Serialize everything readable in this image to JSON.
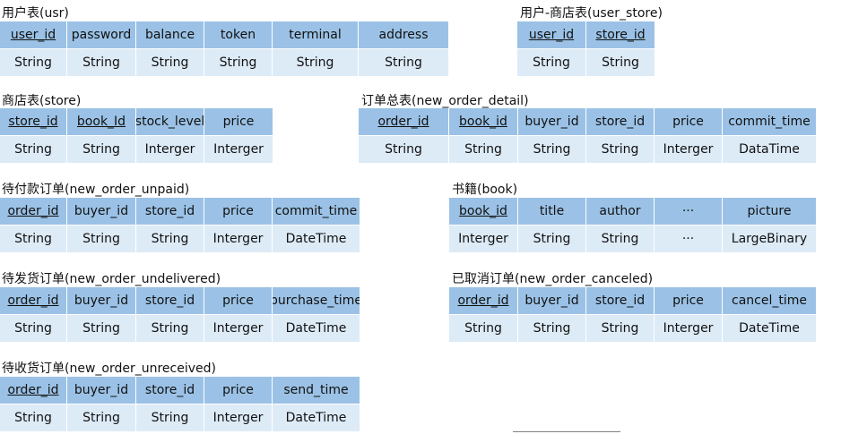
{
  "tables": {
    "usr": {
      "title": "用户表(usr)",
      "columns": [
        "user_id",
        "password",
        "balance",
        "token",
        "terminal",
        "address"
      ],
      "types": [
        "String",
        "String",
        "String",
        "String",
        "String",
        "String"
      ],
      "keys": [
        true,
        false,
        false,
        false,
        false,
        false
      ]
    },
    "user_store": {
      "title": "用户-商店表(user_store)",
      "columns": [
        "user_id",
        "store_id"
      ],
      "types": [
        "String",
        "String"
      ],
      "keys": [
        true,
        true
      ]
    },
    "store": {
      "title": "商店表(store)",
      "columns": [
        "store_id",
        "book_Id",
        "stock_level",
        "price"
      ],
      "types": [
        "String",
        "String",
        "Interger",
        "Interger"
      ],
      "keys": [
        true,
        true,
        false,
        false
      ]
    },
    "new_order_detail": {
      "title": "订单总表(new_order_detail)",
      "columns": [
        "order_id",
        "book_id",
        "buyer_id",
        "store_id",
        "price",
        "commit_time"
      ],
      "types": [
        "String",
        "String",
        "String",
        "String",
        "Interger",
        "DataTime"
      ],
      "keys": [
        true,
        true,
        false,
        false,
        false,
        false
      ]
    },
    "new_order_unpaid": {
      "title": "待付款订单(new_order_unpaid)",
      "columns": [
        "order_id",
        "buyer_id",
        "store_id",
        "price",
        "commit_time"
      ],
      "types": [
        "String",
        "String",
        "String",
        "Interger",
        "DateTime"
      ],
      "keys": [
        true,
        false,
        false,
        false,
        false
      ]
    },
    "book": {
      "title": "书籍(book)",
      "columns": [
        "book_id",
        "title",
        "author",
        "···",
        "picture"
      ],
      "types": [
        "Interger",
        "String",
        "String",
        "···",
        "LargeBinary"
      ],
      "keys": [
        true,
        false,
        false,
        false,
        false
      ]
    },
    "new_order_undelivered": {
      "title": "待发货订单(new_order_undelivered)",
      "columns": [
        "order_id",
        "buyer_id",
        "store_id",
        "price",
        "purchase_time"
      ],
      "types": [
        "String",
        "String",
        "String",
        "Interger",
        "DateTime"
      ],
      "keys": [
        true,
        false,
        false,
        false,
        false
      ]
    },
    "new_order_canceled": {
      "title": "已取消订单(new_order_canceled)",
      "columns": [
        "order_id",
        "buyer_id",
        "store_id",
        "price",
        "cancel_time"
      ],
      "types": [
        "String",
        "String",
        "String",
        "Interger",
        "DateTime"
      ],
      "keys": [
        true,
        false,
        false,
        false,
        false
      ]
    },
    "new_order_unreceived": {
      "title": "待收货订单(new_order_unreceived)",
      "columns": [
        "order_id",
        "buyer_id",
        "store_id",
        "price",
        "send_time"
      ],
      "types": [
        "String",
        "String",
        "String",
        "Interger",
        "DateTime"
      ],
      "keys": [
        true,
        false,
        false,
        false,
        false
      ]
    }
  }
}
